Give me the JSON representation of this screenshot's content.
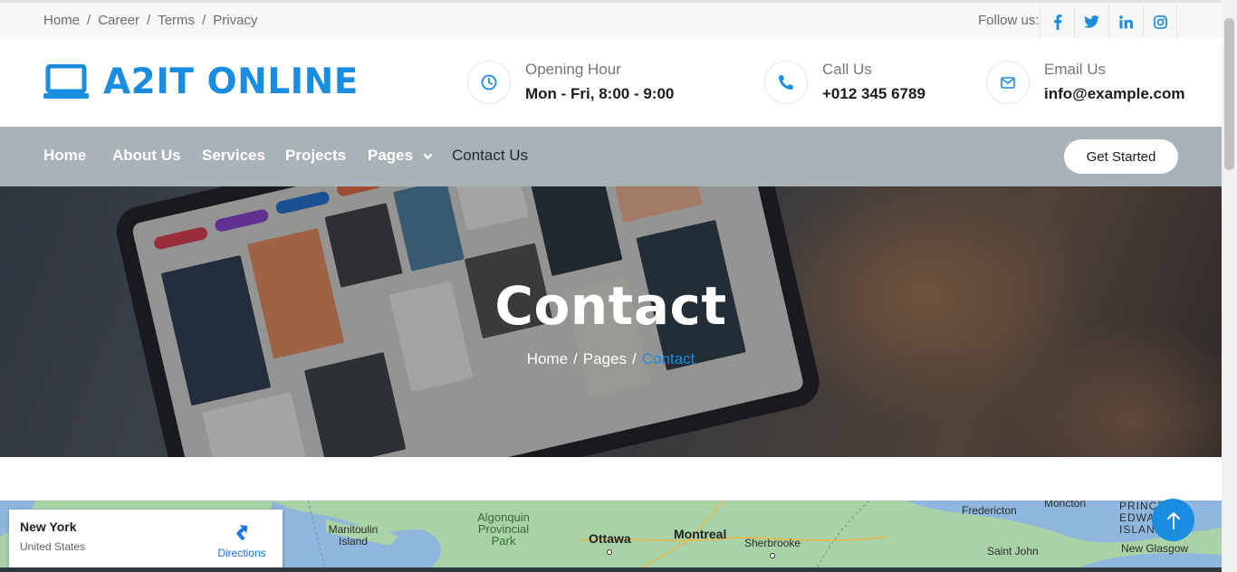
{
  "topbar": {
    "links": [
      "Home",
      "Career",
      "Terms",
      "Privacy"
    ],
    "separator": "/",
    "follow_label": "Follow us:",
    "social": [
      "facebook-icon",
      "twitter-icon",
      "linkedin-icon",
      "instagram-icon"
    ],
    "social_glyphs": [
      "f",
      "t",
      "in",
      "ig"
    ]
  },
  "header": {
    "brand": "A2IT ONLINE",
    "opening": {
      "label": "Opening Hour",
      "value": "Mon - Fri, 8:00 - 9:00",
      "icon": "clock-icon"
    },
    "call": {
      "label": "Call Us",
      "value": "+012 345 6789",
      "icon": "phone-icon"
    },
    "email": {
      "label": "Email Us",
      "value": "info@example.com",
      "icon": "envelope-icon"
    }
  },
  "nav": {
    "items": [
      "Home",
      "About Us",
      "Services",
      "Projects",
      "Pages",
      "Contact Us"
    ],
    "cta": "Get Started"
  },
  "hero": {
    "title": "Contact",
    "breadcrumb": [
      "Home",
      "Pages",
      "Contact"
    ],
    "separator": "/"
  },
  "map": {
    "card": {
      "city": "New York",
      "country": "United States",
      "directions": "Directions"
    },
    "labels": {
      "manitoulin": "Manitoulin Island",
      "algonquin": "Algonquin Provincial Park",
      "ottawa": "Ottawa",
      "montreal": "Montreal",
      "sherbrooke": "Sherbrooke",
      "fredericton": "Fredericton",
      "moncton": "Moncton",
      "prince": "PRINCE EDWARD ISLAND",
      "saint_john": "Saint John",
      "new_glasgow": "New Glasgow"
    }
  },
  "colors": {
    "accent": "#1a8de0",
    "nav_bg": "#a9b2b7",
    "topbar_bg": "#f7f7f7"
  }
}
